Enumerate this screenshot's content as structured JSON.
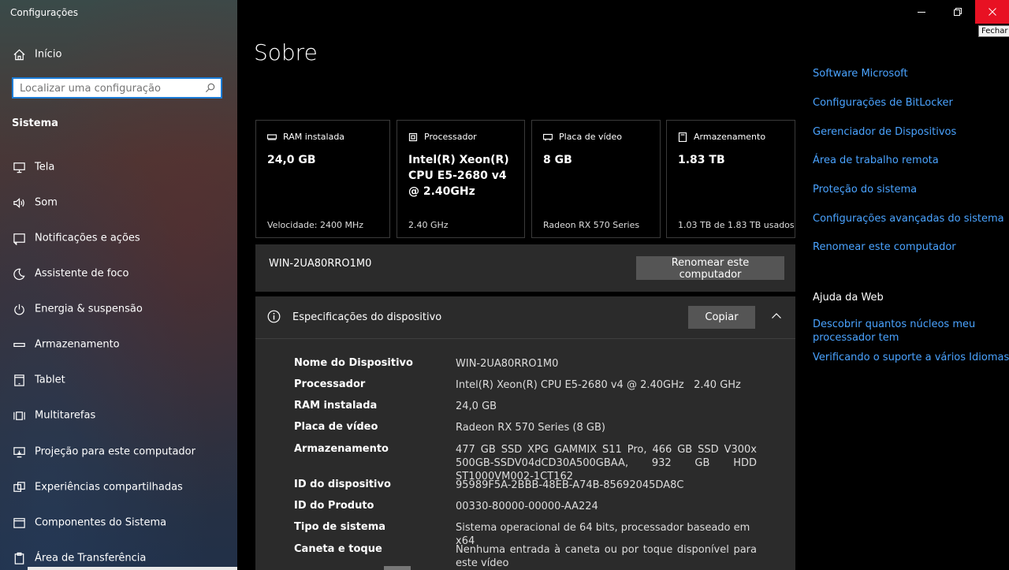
{
  "window": {
    "app_title": "Configurações",
    "close_tooltip": "Fechar"
  },
  "sidebar": {
    "home_label": "Início",
    "search_placeholder": "Localizar uma configuração",
    "section_title": "Sistema",
    "items": [
      {
        "label": "Tela",
        "icon": "monitor-icon"
      },
      {
        "label": "Som",
        "icon": "speaker-icon"
      },
      {
        "label": "Notificações e ações",
        "icon": "notification-icon"
      },
      {
        "label": "Assistente de foco",
        "icon": "moon-icon"
      },
      {
        "label": "Energia & suspensão",
        "icon": "power-icon"
      },
      {
        "label": "Armazenamento",
        "icon": "storage-icon"
      },
      {
        "label": "Tablet",
        "icon": "tablet-icon"
      },
      {
        "label": "Multitarefas",
        "icon": "multitask-icon"
      },
      {
        "label": "Projeção para este computador",
        "icon": "projection-icon"
      },
      {
        "label": "Experiências compartilhadas",
        "icon": "shared-icon"
      },
      {
        "label": "Componentes do Sistema",
        "icon": "components-icon"
      },
      {
        "label": "Área de Transferência",
        "icon": "clipboard-icon"
      }
    ]
  },
  "main": {
    "page_title": "Sobre",
    "cards": [
      {
        "title": "RAM instalada",
        "value": "24,0 GB",
        "footer": "Velocidade: 2400 MHz",
        "icon": "ram-icon"
      },
      {
        "title": "Processador",
        "value": "Intel(R) Xeon(R) CPU E5-2680 v4 @ 2.40GHz",
        "footer": "2.40 GHz",
        "icon": "cpu-icon"
      },
      {
        "title": "Placa de vídeo",
        "value": "8 GB",
        "footer": "Radeon RX 570 Series",
        "icon": "gpu-icon"
      },
      {
        "title": "Armazenamento",
        "value": "1.83 TB",
        "footer": "1.03 TB de 1.83 TB usados",
        "icon": "storage-icon"
      }
    ],
    "computer_name": "WIN-2UA80RRO1M0",
    "rename_button": "Renomear este computador",
    "specs": {
      "title": "Especificações do dispositivo",
      "copy_button": "Copiar",
      "rows": [
        {
          "key": "Nome do Dispositivo",
          "value": "WIN-2UA80RRO1M0"
        },
        {
          "key": "Processador",
          "value": "Intel(R) Xeon(R) CPU E5-2680 v4 @ 2.40GHz   2.40 GHz"
        },
        {
          "key": "RAM instalada",
          "value": "24,0 GB"
        },
        {
          "key": "Placa de vídeo",
          "value": "Radeon RX 570 Series (8 GB)"
        },
        {
          "key": "Armazenamento",
          "value": "477 GB SSD XPG GAMMIX S11 Pro, 466 GB SSD V300x 500GB-SSDV04dCD30A500GBAA, 932 GB HDD ST1000VM002-1CT162"
        },
        {
          "key": "ID do dispositivo",
          "value": "95989F5A-2BBB-48EB-A74B-85692045DA8C"
        },
        {
          "key": "ID do Produto",
          "value": "00330-80000-00000-AA224"
        },
        {
          "key": "Tipo de sistema",
          "value": "Sistema operacional de 64 bits, processador baseado em x64"
        },
        {
          "key": "Caneta e toque",
          "value": "Nenhuma entrada à caneta ou por toque disponível para este vídeo"
        }
      ]
    }
  },
  "related": {
    "links": [
      "Software Microsoft",
      "Configurações de BitLocker",
      "Gerenciador de Dispositivos",
      "Área de trabalho remota",
      "Proteção do sistema",
      "Configurações avançadas do sistema",
      "Renomear este computador"
    ],
    "web_help_title": "Ajuda da Web",
    "web_links": [
      "Descobrir quantos núcleos meu processador tem",
      "Verificando o suporte a vários Idiomas"
    ]
  },
  "colors": {
    "accent": "#1c7cd6",
    "link": "#4aa3ff",
    "close_red": "#e81123"
  }
}
